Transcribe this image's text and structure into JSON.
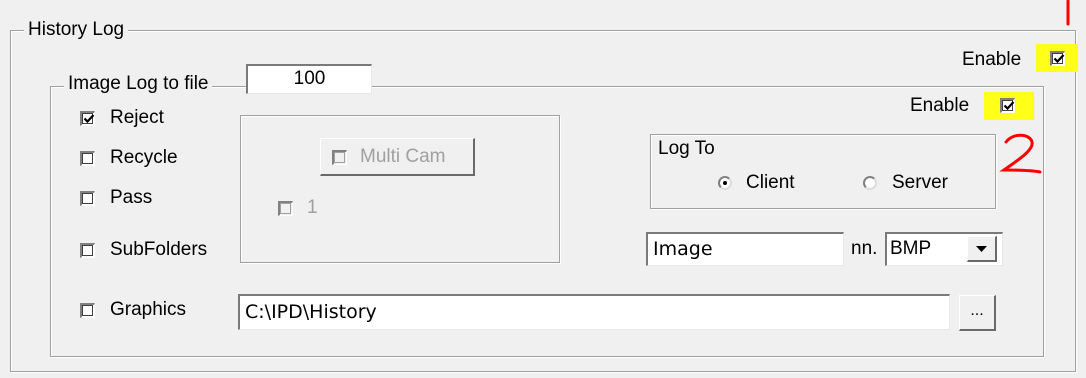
{
  "history_log": {
    "title": "History Log",
    "enable_label": "Enable",
    "enable_checked": true
  },
  "image_log": {
    "title": "Image Log to file",
    "count_value": "100",
    "enable_label": "Enable",
    "enable_checked": true,
    "checkboxes": [
      {
        "label": "Reject",
        "checked": true
      },
      {
        "label": "Recycle",
        "checked": false
      },
      {
        "label": "Pass",
        "checked": false
      },
      {
        "label": "SubFolders",
        "checked": false
      },
      {
        "label": "Graphics",
        "checked": false
      }
    ],
    "camera_box": {
      "multi_cam_label": "Multi Cam",
      "cam1_label": "1"
    },
    "log_to": {
      "title": "Log To",
      "options": [
        {
          "label": "Client",
          "selected": true
        },
        {
          "label": "Server",
          "selected": false
        }
      ]
    },
    "filename_value": "Image",
    "ext_label": "nn.",
    "format_value": "BMP",
    "path_value": "C:\\IPD\\History",
    "browse_label": "..."
  },
  "annotations": {
    "mark_1": "1",
    "mark_2": "2",
    "highlight_color": "#ffff1a",
    "mark_color": "#ff0000"
  }
}
